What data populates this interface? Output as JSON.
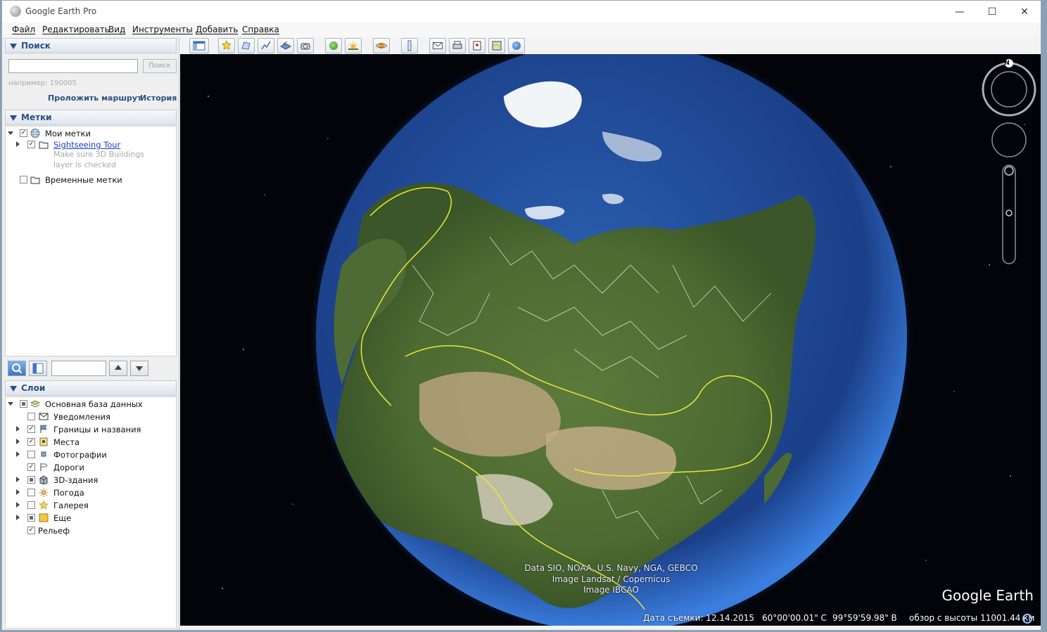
{
  "window": {
    "title": "Google Earth Pro",
    "controls": {
      "minimize": "—",
      "maximize": "☐",
      "close": "✕"
    }
  },
  "menu": [
    "Файл",
    "Редактировать",
    "Вид",
    "Инструменты",
    "Добавить",
    "Справка"
  ],
  "search": {
    "header": "Поиск",
    "input_value": "",
    "button": "Поиск",
    "hint": "например: 190005",
    "route_link": "Проложить маршрут",
    "history_link": "История"
  },
  "places": {
    "header": "Метки",
    "items": [
      {
        "label": "Мои метки",
        "checked": true
      },
      {
        "label": "Sightseeing Tour",
        "checked": true,
        "note_line1": "Make sure 3D Buildings",
        "note_line2": "layer is checked"
      },
      {
        "label": "Временные метки",
        "checked": false
      }
    ]
  },
  "layers": {
    "header": "Слои",
    "items": [
      {
        "label": "Основная база данных",
        "state": "partial"
      },
      {
        "label": "Уведомления",
        "state": "unchecked"
      },
      {
        "label": "Границы и названия",
        "state": "checked"
      },
      {
        "label": "Места",
        "state": "checked"
      },
      {
        "label": "Фотографии",
        "state": "unchecked"
      },
      {
        "label": "Дороги",
        "state": "checked"
      },
      {
        "label": "3D-здания",
        "state": "partial"
      },
      {
        "label": "Погода",
        "state": "unchecked"
      },
      {
        "label": "Галерея",
        "state": "unchecked"
      },
      {
        "label": "Еще",
        "state": "partial"
      },
      {
        "label": "Рельеф",
        "state": "checked"
      }
    ]
  },
  "navigation": {
    "north_label": "N"
  },
  "map": {
    "attribution": [
      "Data SIO, NOAA, U.S. Navy, NGA, GEBCO",
      "Image Landsat / Copernicus",
      "Image IBCAO"
    ],
    "logo": "Google Earth"
  },
  "status": {
    "imagery_date": "Дата съемки: 12.14.2015",
    "latitude": "60°00'00.01\" С",
    "longitude": "99°59'59.98\" В",
    "eye_alt": "обзор с высоты 11001.44 км"
  }
}
